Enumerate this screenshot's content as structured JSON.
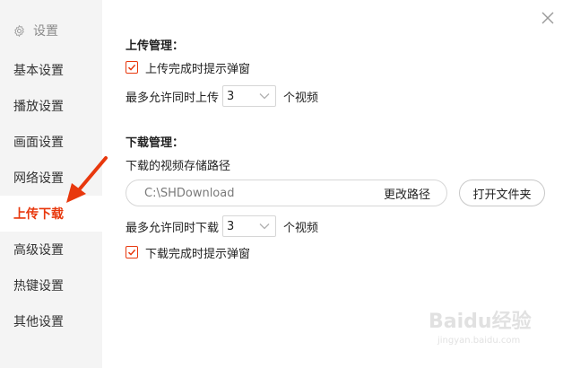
{
  "sidebar": {
    "title": "设置",
    "items": [
      {
        "label": "基本设置"
      },
      {
        "label": "播放设置"
      },
      {
        "label": "画面设置"
      },
      {
        "label": "网络设置"
      },
      {
        "label": "上传下载",
        "active": true
      },
      {
        "label": "高级设置"
      },
      {
        "label": "热键设置"
      },
      {
        "label": "其他设置"
      }
    ]
  },
  "upload": {
    "title": "上传管理：",
    "notify_label": "上传完成时提示弹窗",
    "notify_checked": true,
    "max_label": "最多允许同时上传",
    "max_value": "3",
    "unit": "个视频"
  },
  "download": {
    "title": "下载管理：",
    "path_label": "下载的视频存储路径",
    "path_value": "C:\\SHDownload",
    "change_path": "更改路径",
    "open_folder": "打开文件夹",
    "max_label": "最多允许同时下载",
    "max_value": "3",
    "unit": "个视频",
    "notify_label": "下载完成时提示弹窗",
    "notify_checked": true
  },
  "watermark": {
    "logo": "Baidu经验",
    "url": "jingyan.baidu.com"
  },
  "colors": {
    "accent": "#e8380d",
    "sidebar_bg": "#f4f4f4",
    "arrow": "#e8380d"
  }
}
